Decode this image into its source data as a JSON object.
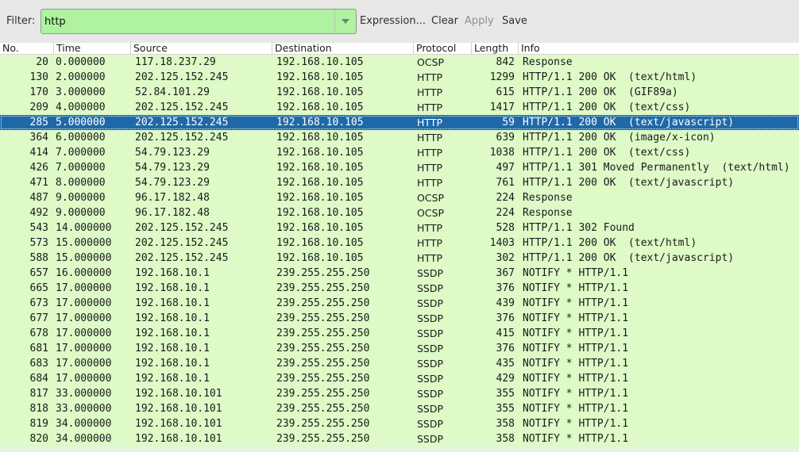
{
  "toolbar": {
    "filter_label": "Filter:",
    "filter_value": "http",
    "filter_bg": "#aff3a0",
    "expression_label": "Expression...",
    "clear_label": "Clear",
    "apply_label": "Apply",
    "save_label": "Save"
  },
  "columns": {
    "no": "No.",
    "time": "Time",
    "source": "Source",
    "destination": "Destination",
    "protocol": "Protocol",
    "length": "Length",
    "info": "Info"
  },
  "colors": {
    "row_bg": "#ddfac7",
    "selected_bg": "#1f69a8",
    "selected_fg": "#ffffff"
  },
  "selected_index": 4,
  "packets": [
    {
      "no": "20",
      "time": "0.000000",
      "source": "117.18.237.29",
      "destination": "192.168.10.105",
      "protocol": "OCSP",
      "length": "842",
      "info": "Response"
    },
    {
      "no": "130",
      "time": "2.000000",
      "source": "202.125.152.245",
      "destination": "192.168.10.105",
      "protocol": "HTTP",
      "length": "1299",
      "info": "HTTP/1.1 200 OK  (text/html)"
    },
    {
      "no": "170",
      "time": "3.000000",
      "source": "52.84.101.29",
      "destination": "192.168.10.105",
      "protocol": "HTTP",
      "length": "615",
      "info": "HTTP/1.1 200 OK  (GIF89a)"
    },
    {
      "no": "209",
      "time": "4.000000",
      "source": "202.125.152.245",
      "destination": "192.168.10.105",
      "protocol": "HTTP",
      "length": "1417",
      "info": "HTTP/1.1 200 OK  (text/css)"
    },
    {
      "no": "285",
      "time": "5.000000",
      "source": "202.125.152.245",
      "destination": "192.168.10.105",
      "protocol": "HTTP",
      "length": "59",
      "info": "HTTP/1.1 200 OK  (text/javascript)"
    },
    {
      "no": "364",
      "time": "6.000000",
      "source": "202.125.152.245",
      "destination": "192.168.10.105",
      "protocol": "HTTP",
      "length": "639",
      "info": "HTTP/1.1 200 OK  (image/x-icon)"
    },
    {
      "no": "414",
      "time": "7.000000",
      "source": "54.79.123.29",
      "destination": "192.168.10.105",
      "protocol": "HTTP",
      "length": "1038",
      "info": "HTTP/1.1 200 OK  (text/css)"
    },
    {
      "no": "426",
      "time": "7.000000",
      "source": "54.79.123.29",
      "destination": "192.168.10.105",
      "protocol": "HTTP",
      "length": "497",
      "info": "HTTP/1.1 301 Moved Permanently  (text/html)"
    },
    {
      "no": "471",
      "time": "8.000000",
      "source": "54.79.123.29",
      "destination": "192.168.10.105",
      "protocol": "HTTP",
      "length": "761",
      "info": "HTTP/1.1 200 OK  (text/javascript)"
    },
    {
      "no": "487",
      "time": "9.000000",
      "source": "96.17.182.48",
      "destination": "192.168.10.105",
      "protocol": "OCSP",
      "length": "224",
      "info": "Response"
    },
    {
      "no": "492",
      "time": "9.000000",
      "source": "96.17.182.48",
      "destination": "192.168.10.105",
      "protocol": "OCSP",
      "length": "224",
      "info": "Response"
    },
    {
      "no": "543",
      "time": "14.000000",
      "source": "202.125.152.245",
      "destination": "192.168.10.105",
      "protocol": "HTTP",
      "length": "528",
      "info": "HTTP/1.1 302 Found"
    },
    {
      "no": "573",
      "time": "15.000000",
      "source": "202.125.152.245",
      "destination": "192.168.10.105",
      "protocol": "HTTP",
      "length": "1403",
      "info": "HTTP/1.1 200 OK  (text/html)"
    },
    {
      "no": "588",
      "time": "15.000000",
      "source": "202.125.152.245",
      "destination": "192.168.10.105",
      "protocol": "HTTP",
      "length": "302",
      "info": "HTTP/1.1 200 OK  (text/javascript)"
    },
    {
      "no": "657",
      "time": "16.000000",
      "source": "192.168.10.1",
      "destination": "239.255.255.250",
      "protocol": "SSDP",
      "length": "367",
      "info": "NOTIFY * HTTP/1.1"
    },
    {
      "no": "665",
      "time": "17.000000",
      "source": "192.168.10.1",
      "destination": "239.255.255.250",
      "protocol": "SSDP",
      "length": "376",
      "info": "NOTIFY * HTTP/1.1"
    },
    {
      "no": "673",
      "time": "17.000000",
      "source": "192.168.10.1",
      "destination": "239.255.255.250",
      "protocol": "SSDP",
      "length": "439",
      "info": "NOTIFY * HTTP/1.1"
    },
    {
      "no": "677",
      "time": "17.000000",
      "source": "192.168.10.1",
      "destination": "239.255.255.250",
      "protocol": "SSDP",
      "length": "376",
      "info": "NOTIFY * HTTP/1.1"
    },
    {
      "no": "678",
      "time": "17.000000",
      "source": "192.168.10.1",
      "destination": "239.255.255.250",
      "protocol": "SSDP",
      "length": "415",
      "info": "NOTIFY * HTTP/1.1"
    },
    {
      "no": "681",
      "time": "17.000000",
      "source": "192.168.10.1",
      "destination": "239.255.255.250",
      "protocol": "SSDP",
      "length": "376",
      "info": "NOTIFY * HTTP/1.1"
    },
    {
      "no": "683",
      "time": "17.000000",
      "source": "192.168.10.1",
      "destination": "239.255.255.250",
      "protocol": "SSDP",
      "length": "435",
      "info": "NOTIFY * HTTP/1.1"
    },
    {
      "no": "684",
      "time": "17.000000",
      "source": "192.168.10.1",
      "destination": "239.255.255.250",
      "protocol": "SSDP",
      "length": "429",
      "info": "NOTIFY * HTTP/1.1"
    },
    {
      "no": "817",
      "time": "33.000000",
      "source": "192.168.10.101",
      "destination": "239.255.255.250",
      "protocol": "SSDP",
      "length": "355",
      "info": "NOTIFY * HTTP/1.1"
    },
    {
      "no": "818",
      "time": "33.000000",
      "source": "192.168.10.101",
      "destination": "239.255.255.250",
      "protocol": "SSDP",
      "length": "355",
      "info": "NOTIFY * HTTP/1.1"
    },
    {
      "no": "819",
      "time": "34.000000",
      "source": "192.168.10.101",
      "destination": "239.255.255.250",
      "protocol": "SSDP",
      "length": "358",
      "info": "NOTIFY * HTTP/1.1"
    },
    {
      "no": "820",
      "time": "34.000000",
      "source": "192.168.10.101",
      "destination": "239.255.255.250",
      "protocol": "SSDP",
      "length": "358",
      "info": "NOTIFY * HTTP/1.1"
    }
  ]
}
